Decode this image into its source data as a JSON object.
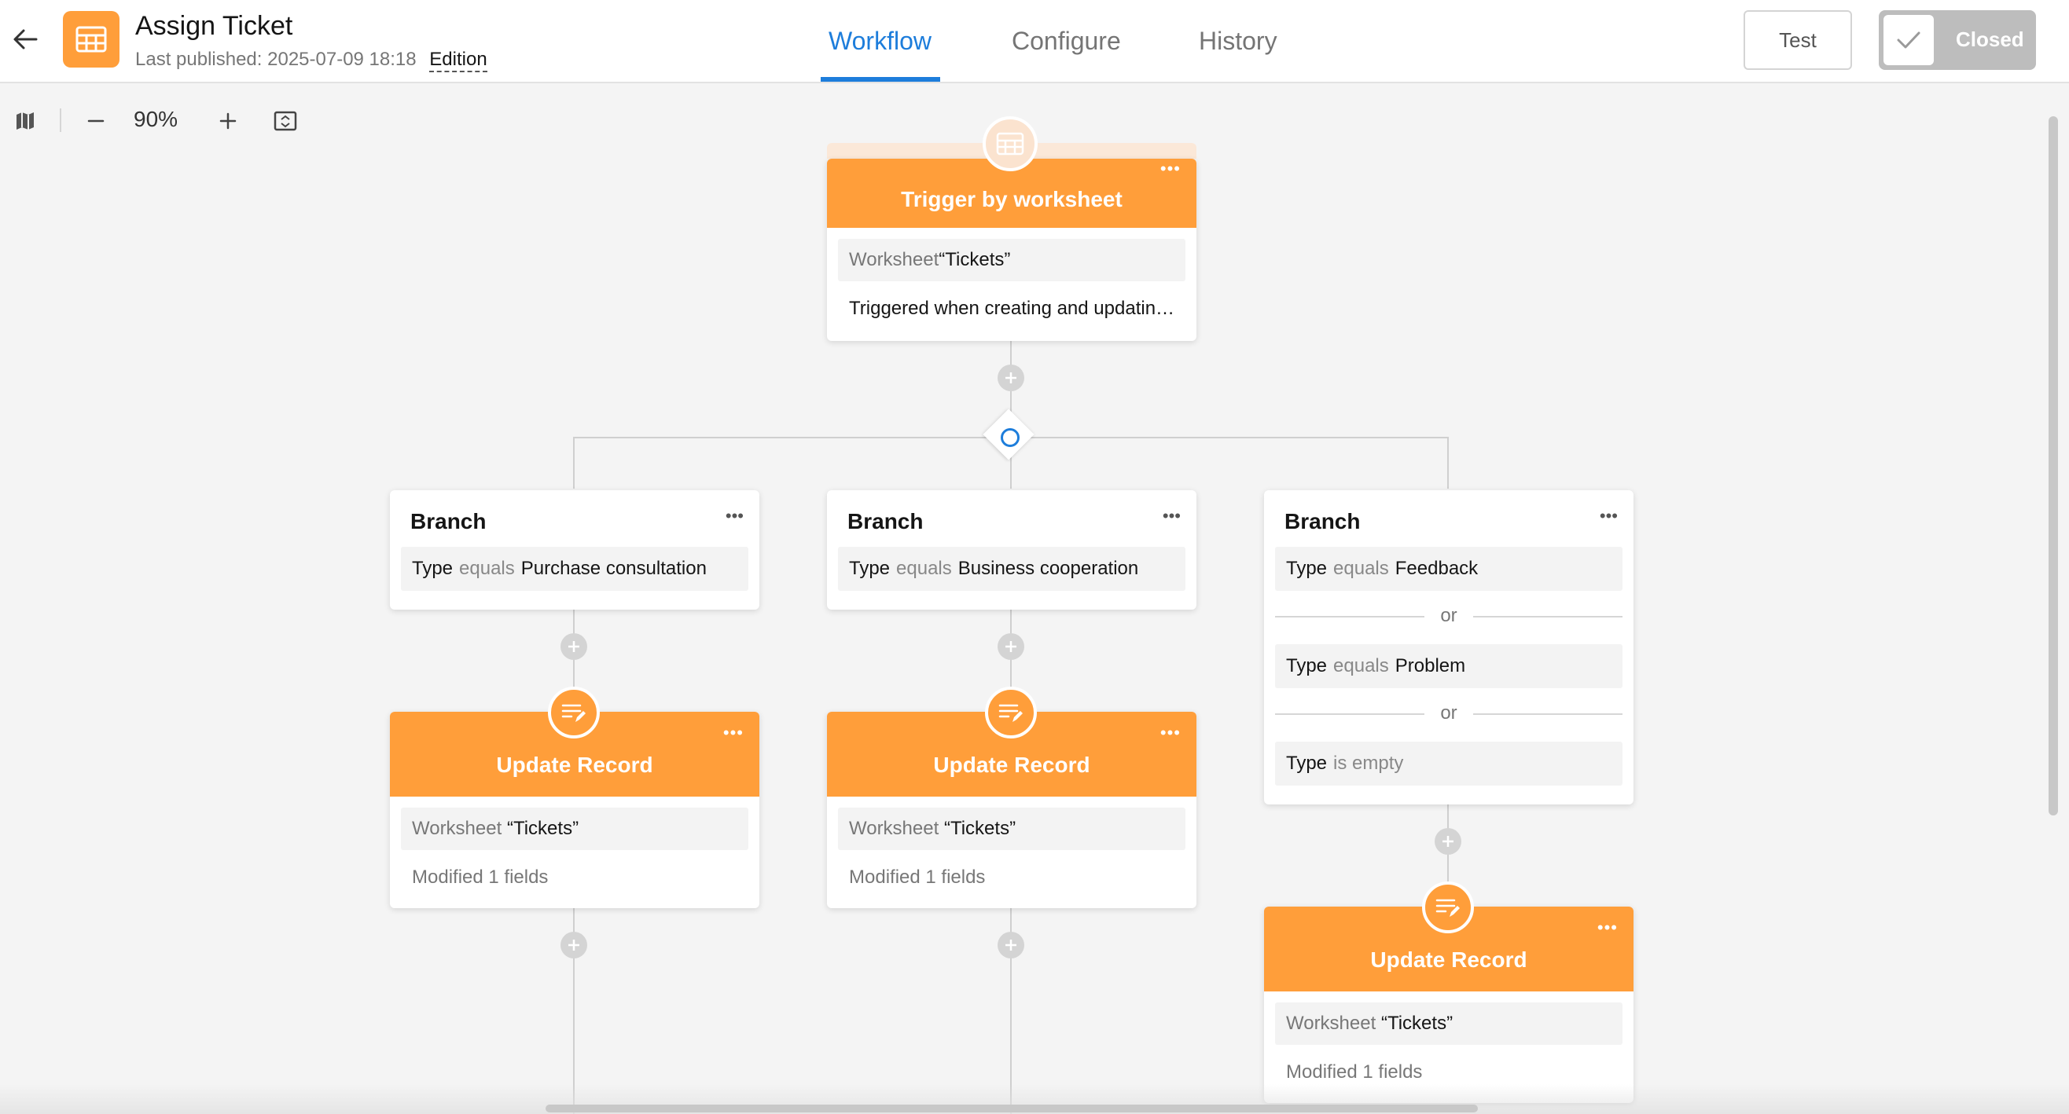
{
  "header": {
    "title": "Assign Ticket",
    "last_published_label": "Last published:",
    "last_published_value": "2025-07-09 18:18",
    "edition_label": "Edition",
    "tabs": [
      {
        "label": "Workflow",
        "active": true
      },
      {
        "label": "Configure",
        "active": false
      },
      {
        "label": "History",
        "active": false
      }
    ],
    "test_label": "Test",
    "status_label": "Closed",
    "app_icon": "grid-table-icon",
    "accent_color": "#ff9e3a",
    "active_tab_color": "#1d7ddb"
  },
  "toolbar": {
    "zoom": "90%",
    "icons": [
      "map-icon",
      "zoom-out-icon",
      "zoom-in-icon",
      "fit-screen-icon"
    ]
  },
  "trigger": {
    "title": "Trigger by worksheet",
    "worksheet_key": "Worksheet",
    "worksheet_value": "“Tickets”",
    "description": "Triggered when creating and updatin…",
    "icon": "grid-table-icon"
  },
  "branches": [
    {
      "title": "Branch",
      "conditions": [
        {
          "field": "Type",
          "operator": "equals",
          "value": "Purchase consultation"
        }
      ],
      "action": {
        "title": "Update Record",
        "worksheet_key": "Worksheet",
        "worksheet_value": "“Tickets”",
        "summary": "Modified 1 fields",
        "icon": "edit-record-icon"
      }
    },
    {
      "title": "Branch",
      "conditions": [
        {
          "field": "Type",
          "operator": "equals",
          "value": "Business cooperation"
        }
      ],
      "action": {
        "title": "Update Record",
        "worksheet_key": "Worksheet",
        "worksheet_value": "“Tickets”",
        "summary": "Modified 1 fields",
        "icon": "edit-record-icon"
      }
    },
    {
      "title": "Branch",
      "conditions": [
        {
          "field": "Type",
          "operator": "equals",
          "value": "Feedback"
        },
        {
          "field": "Type",
          "operator": "equals",
          "value": "Problem"
        },
        {
          "field": "Type",
          "operator": "is empty",
          "value": ""
        }
      ],
      "separator": "or",
      "action": {
        "title": "Update Record",
        "worksheet_key": "Worksheet",
        "worksheet_value": "“Tickets”",
        "summary": "Modified 1 fields",
        "icon": "edit-record-icon"
      }
    }
  ]
}
